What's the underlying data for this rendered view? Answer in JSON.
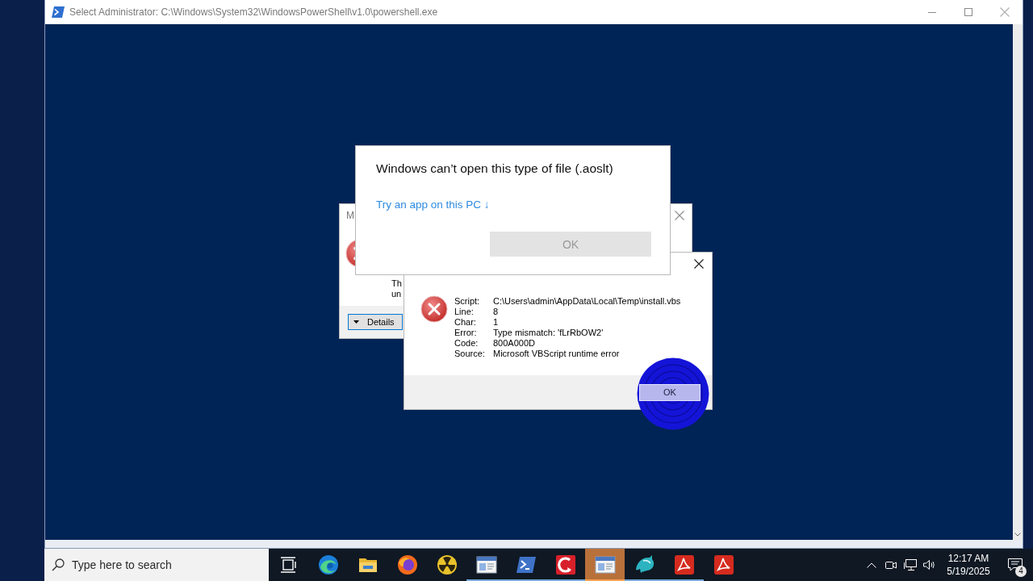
{
  "powershell_window": {
    "title": "Select Administrator: C:\\Windows\\System32\\WindowsPowerShell\\v1.0\\powershell.exe",
    "active": false
  },
  "background_dialog": {
    "title": "M",
    "message_lines": [
      "Th",
      "un"
    ],
    "details_button": "Details"
  },
  "file_type_dialog": {
    "heading": "Windows can’t open this type of file (.aoslt)",
    "link": "Try an app on this PC ↓",
    "ok_button": {
      "label": "OK",
      "disabled": true
    }
  },
  "script_error_dialog": {
    "fields": [
      {
        "label": "Script:",
        "value": "C:\\Users\\admin\\AppData\\Local\\Temp\\install.vbs"
      },
      {
        "label": "Line:",
        "value": "8"
      },
      {
        "label": "Char:",
        "value": "1"
      },
      {
        "label": "Error:",
        "value": "Type mismatch: 'fLrRbOW2'"
      },
      {
        "label": "Code:",
        "value": "800A000D"
      },
      {
        "label": "Source:",
        "value": "Microsoft VBScript runtime error"
      }
    ],
    "ok_button": {
      "label": "OK"
    }
  },
  "taskbar": {
    "search": {
      "placeholder": "Type here to search"
    },
    "apps": [
      {
        "kind": "task-view",
        "running": false,
        "selected": false
      },
      {
        "kind": "swirl",
        "running": false,
        "selected": false
      },
      {
        "kind": "folder",
        "running": false,
        "selected": false
      },
      {
        "kind": "fox",
        "running": false,
        "selected": false
      },
      {
        "kind": "radiation",
        "running": false,
        "selected": false
      },
      {
        "kind": "window",
        "running": true,
        "selected": false
      },
      {
        "kind": "terminal",
        "running": true,
        "selected": false
      },
      {
        "kind": "arc",
        "running": true,
        "selected": false
      },
      {
        "kind": "window",
        "running": true,
        "selected": true
      },
      {
        "kind": "dolphin",
        "running": true,
        "selected": false
      },
      {
        "kind": "pdf",
        "running": true,
        "selected": false
      },
      {
        "kind": "pdf",
        "running": false,
        "selected": false
      }
    ],
    "tray": {
      "time": "12:17 AM",
      "date": "5/19/2025",
      "notification_count": "4"
    }
  }
}
